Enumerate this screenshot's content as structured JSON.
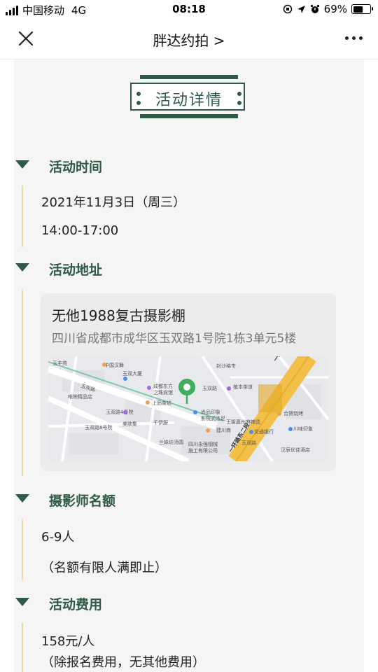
{
  "status_bar": {
    "carrier": "中国移动",
    "network": "4G",
    "time": "08:18",
    "battery_percent": "69%",
    "battery_level": 0.69
  },
  "nav": {
    "title": "胖达约拍 >",
    "close_icon": "close-icon",
    "more_icon": "more-icon"
  },
  "badge": {
    "title": "活动详情"
  },
  "sections": {
    "time": {
      "title": "活动时间",
      "date": "2021年11月3日（周三）",
      "hours": "14:00-17:00"
    },
    "address": {
      "title": "活动地址",
      "place_name": "无他1988复古摄影棚",
      "place_detail": "四川省成都市成华区玉双路1号院1栋3单元5楼"
    },
    "quota": {
      "title": "摄影师名额",
      "count": "6-9人",
      "note": "（名额有限人满即止）"
    },
    "fee": {
      "title": "活动费用",
      "price": "158元/人",
      "note": "（除报名费用，无其他费用）"
    }
  },
  "map_labels": {
    "l1": "玉丰苑",
    "l2": "中国汉舞",
    "l3": "玉双大厦",
    "l4": "成都东方",
    "l5": "之珠宾馆",
    "l6": "玉双路",
    "l7": "上品茶坊",
    "l8": "唯映精品店",
    "l9": "玉双路4号院",
    "l10": "美肤集",
    "l11": "千伊服",
    "l12": "玉双路8号院",
    "l13": "兰妹坊汤圆",
    "l14": "四川永强钢械",
    "l15": "施工有限公司",
    "l16": "尚品印象",
    "l17": "影院式洛足",
    "l18": "王姐嘉州麻辣烫",
    "l19": "交通银行",
    "l20": "植本茶道",
    "l21": "封沙格市",
    "l22": "建川商",
    "l23": "合贺烧烤",
    "l24": "川味印象",
    "l25": "汉辰优佳酒店",
    "l26": "玉双路",
    "l27": "一环路东三段",
    "l28": "一环路东二段",
    "l29": "玉双路"
  },
  "colors": {
    "accent": "#2f5a45",
    "timeline": "#ecd9a3",
    "map_pin": "#3fae5c"
  }
}
